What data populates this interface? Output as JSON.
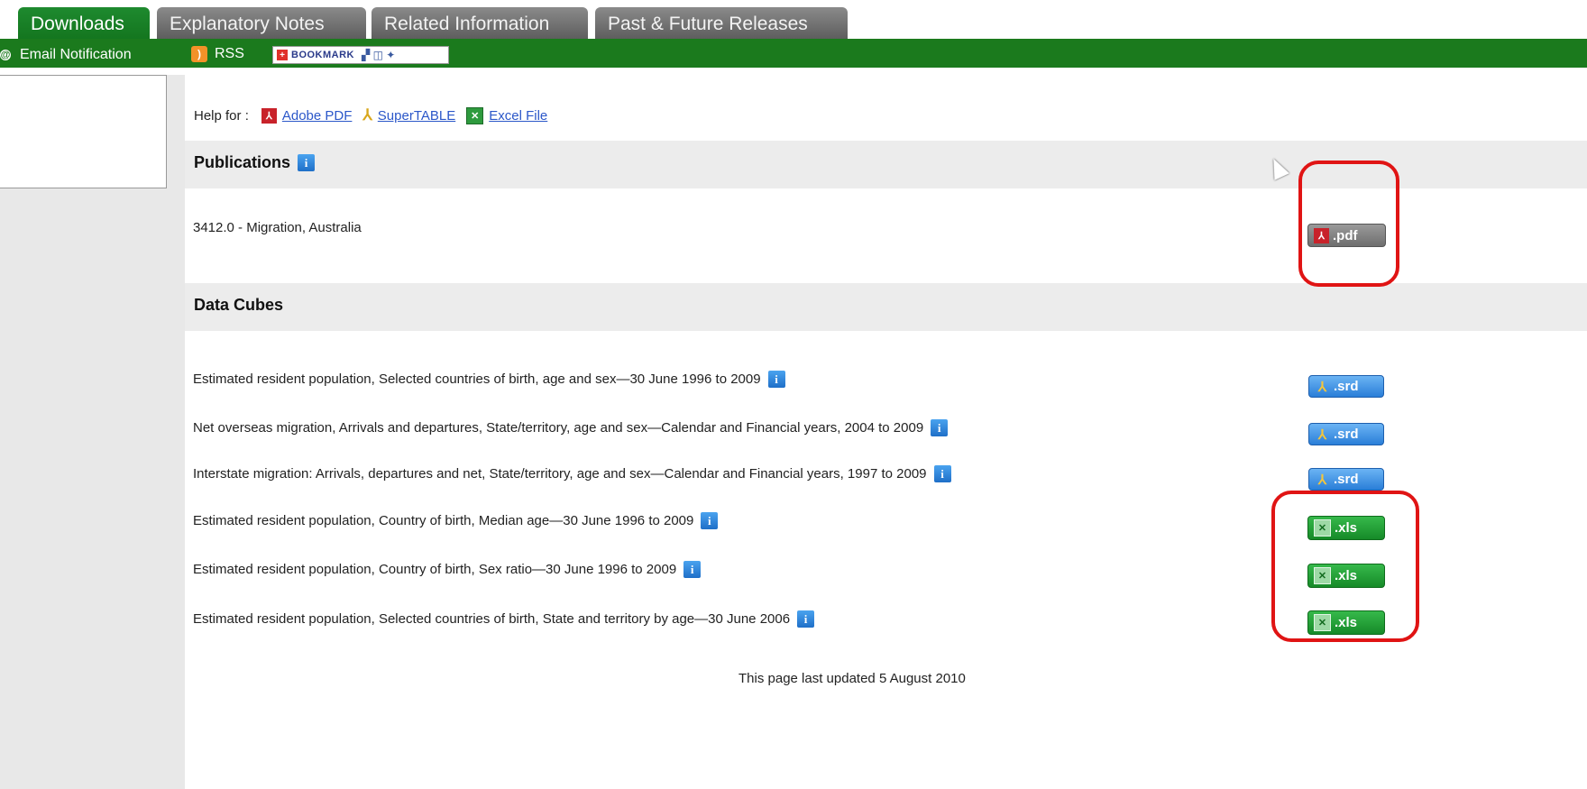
{
  "tabs": [
    {
      "label": "Downloads",
      "active": true
    },
    {
      "label": "Explanatory Notes",
      "active": false
    },
    {
      "label": "Related Information",
      "active": false
    },
    {
      "label": "Past & Future Releases",
      "active": false
    }
  ],
  "toolbar": {
    "email_label": "Email Notification",
    "rss_label": "RSS",
    "bookmark_label": "BOOKMARK"
  },
  "help": {
    "prefix": "Help for :",
    "links": [
      "Adobe PDF",
      "SuperTABLE",
      "Excel File"
    ]
  },
  "publications": {
    "title": "Publications",
    "items": [
      {
        "label": "3412.0 - Migration, Australia",
        "button": ".pdf"
      }
    ]
  },
  "data_cubes": {
    "title": "Data Cubes",
    "items": [
      {
        "label": "Estimated resident population, Selected countries of birth, age and sex—30 June 1996 to 2009",
        "button": ".srd"
      },
      {
        "label": "Net overseas migration, Arrivals and departures, State/territory, age and sex—Calendar and Financial years, 2004 to 2009",
        "button": ".srd"
      },
      {
        "label": "Interstate migration: Arrivals, departures and net, State/territory, age and sex—Calendar and Financial years, 1997 to 2009",
        "button": ".srd"
      },
      {
        "label": "Estimated resident population, Country of birth, Median age—30 June 1996 to 2009",
        "button": ".xls"
      },
      {
        "label": "Estimated resident population, Country of birth, Sex ratio—30 June 1996 to 2009",
        "button": ".xls"
      },
      {
        "label": "Estimated resident population, Selected countries of birth, State and territory by age—30 June 2006",
        "button": ".xls"
      }
    ]
  },
  "footer": {
    "updated": "This page last updated 5 August 2010"
  },
  "colors": {
    "tab_active": "#1e8a2f",
    "toolbar": "#1b7a1d",
    "highlight": "#e01414"
  }
}
